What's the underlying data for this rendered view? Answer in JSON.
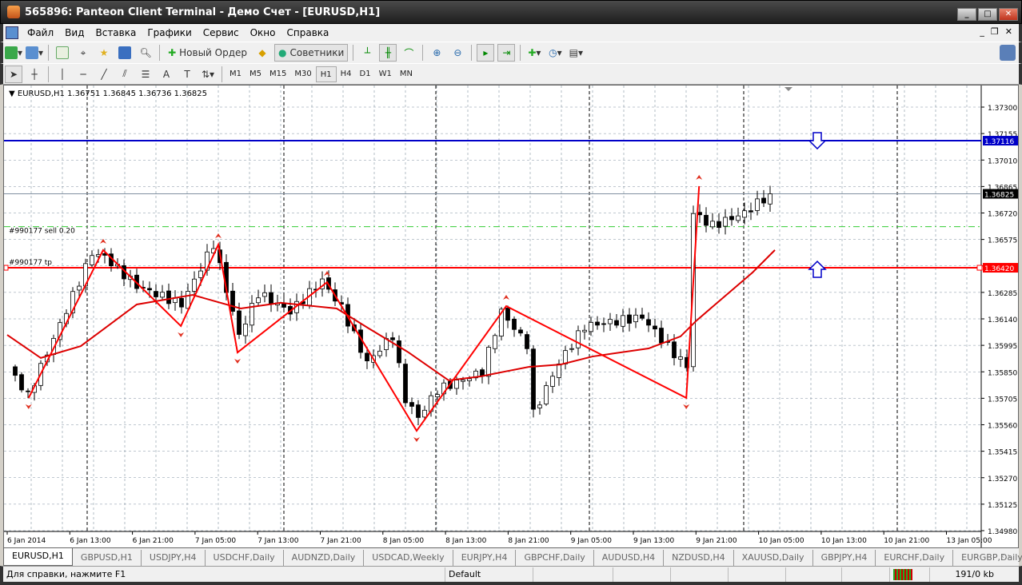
{
  "window": {
    "title": "565896: Panteon Client Terminal - Демо Счет - [EURUSD,H1]",
    "min": "_",
    "max": "□",
    "close": "✕"
  },
  "menu": [
    "Файл",
    "Вид",
    "Вставка",
    "Графики",
    "Сервис",
    "Окно",
    "Справка"
  ],
  "toolbar": {
    "new_order": "Новый Ордер",
    "advisors": "Советники"
  },
  "timeframes": [
    "M1",
    "M5",
    "M15",
    "M30",
    "H1",
    "H4",
    "D1",
    "W1",
    "MN"
  ],
  "active_timeframe": "H1",
  "chart": {
    "header": "EURUSD,H1  1.36751 1.36845 1.36736 1.36825",
    "price_ticks": [
      "1.37300",
      "1.37155",
      "1.37010",
      "1.36865",
      "1.36720",
      "1.36575",
      "1.36420",
      "1.36285",
      "1.36140",
      "1.35995",
      "1.35850",
      "1.35705",
      "1.35560",
      "1.35415",
      "1.35270",
      "1.35125",
      "1.34980"
    ],
    "price_tick_values": [
      1.373,
      1.37155,
      1.3701,
      1.36865,
      1.3672,
      1.36575,
      1.3643,
      1.36285,
      1.3614,
      1.35995,
      1.3585,
      1.35705,
      1.3556,
      1.35415,
      1.3527,
      1.35125,
      1.3498
    ],
    "time_ticks": [
      "6 Jan 2014",
      "6 Jan 13:00",
      "6 Jan 21:00",
      "7 Jan 05:00",
      "7 Jan 13:00",
      "7 Jan 21:00",
      "8 Jan 05:00",
      "8 Jan 13:00",
      "8 Jan 21:00",
      "9 Jan 05:00",
      "9 Jan 13:00",
      "9 Jan 21:00",
      "10 Jan 05:00",
      "10 Jan 13:00",
      "10 Jan 21:00",
      "13 Jan 05:00"
    ],
    "lines": {
      "alert_level": {
        "value": 1.37116,
        "label": "1.37116",
        "color": "#0000c8"
      },
      "bid": {
        "value": 1.36825,
        "label": "1.36825",
        "color": "#000000"
      },
      "tp": {
        "value": 1.3642,
        "label": "1.36420",
        "color": "#ff0000",
        "text": "#990177 tp"
      },
      "order": {
        "value": 1.36645,
        "color": "#33cc33",
        "text": "#990177 sell 0.20"
      }
    },
    "price_keypoints": [
      [
        0,
        1.3587
      ],
      [
        3,
        1.3572
      ],
      [
        13,
        1.365
      ],
      [
        15,
        1.3648
      ],
      [
        20,
        1.3632
      ],
      [
        27,
        1.3622
      ],
      [
        32,
        1.3655
      ],
      [
        36,
        1.3605
      ],
      [
        39,
        1.3628
      ],
      [
        44,
        1.3618
      ],
      [
        49,
        1.3635
      ],
      [
        52,
        1.362
      ],
      [
        56,
        1.359
      ],
      [
        60,
        1.3605
      ],
      [
        62,
        1.357
      ],
      [
        64,
        1.356
      ],
      [
        67,
        1.3575
      ],
      [
        74,
        1.3585
      ],
      [
        77,
        1.3618
      ],
      [
        81,
        1.36
      ],
      [
        82,
        1.3562
      ],
      [
        86,
        1.359
      ],
      [
        90,
        1.361
      ],
      [
        99,
        1.3615
      ],
      [
        104,
        1.3595
      ],
      [
        106,
        1.3588
      ],
      [
        107,
        1.3672
      ],
      [
        110,
        1.3665
      ],
      [
        115,
        1.3672
      ],
      [
        119,
        1.36825
      ]
    ],
    "zigzag": [
      [
        3.1,
        1.35707
      ],
      [
        14.75,
        1.36517
      ],
      [
        26.9,
        1.36101
      ],
      [
        32.75,
        1.36547
      ],
      [
        35.75,
        1.35956
      ],
      [
        49.75,
        1.36341
      ],
      [
        63.75,
        1.35527
      ],
      [
        77.75,
        1.3621
      ],
      [
        105.9,
        1.35707
      ],
      [
        107.9,
        1.36867
      ]
    ],
    "moving_average": [
      [
        -0.25,
        1.36052
      ],
      [
        5,
        1.35926
      ],
      [
        11.25,
        1.35991
      ],
      [
        20,
        1.36219
      ],
      [
        28.75,
        1.36271
      ],
      [
        36.25,
        1.36197
      ],
      [
        42.5,
        1.36228
      ],
      [
        51.25,
        1.36197
      ],
      [
        56.25,
        1.36088
      ],
      [
        62.5,
        1.35956
      ],
      [
        68.75,
        1.35803
      ],
      [
        73.75,
        1.35825
      ],
      [
        81.25,
        1.35877
      ],
      [
        86.25,
        1.3589
      ],
      [
        91.25,
        1.35934
      ],
      [
        100,
        1.35978
      ],
      [
        105,
        1.36044
      ],
      [
        107.5,
        1.36131
      ],
      [
        116.25,
        1.36394
      ],
      [
        119.75,
        1.36517
      ]
    ],
    "colors": {
      "up": "#ffffff",
      "down": "#000000",
      "zigzag": "#ff0000",
      "ma": "#dd0000",
      "grid": "#8090a0"
    }
  },
  "tabs": [
    "EURUSD,H1",
    "GBPUSD,H1",
    "USDJPY,H4",
    "USDCHF,Daily",
    "AUDNZD,Daily",
    "USDCAD,Weekly",
    "EURJPY,H4",
    "GBPCHF,Daily",
    "AUDUSD,H4",
    "NZDUSD,H4",
    "XAUUSD,Daily",
    "GBPJPY,H4",
    "EURCHF,Daily",
    "EURGBP,Daily"
  ],
  "status": {
    "help": "Для справки, нажмите F1",
    "profile": "Default",
    "traffic": "191/0 kb"
  }
}
